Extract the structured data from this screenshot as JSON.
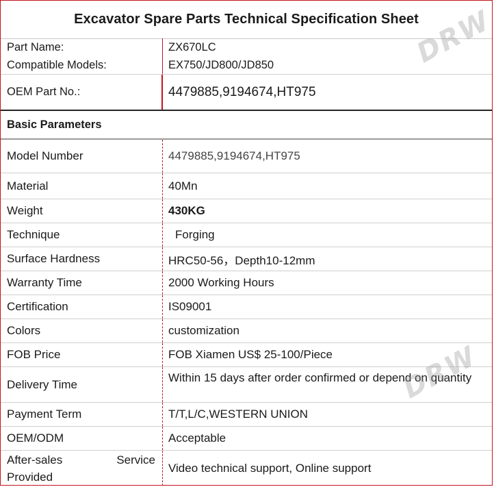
{
  "title": "Excavator Spare Parts Technical Specification Sheet",
  "watermark": "DRW",
  "top_rows": [
    {
      "label": "Part Name:",
      "value": "ZX670LC"
    },
    {
      "label": "Compatible Models:",
      "value": "EX750/JD800/JD850"
    },
    {
      "label": "OEM Part No.:",
      "value": "4479885,9194674,HT975"
    }
  ],
  "section_title": "Basic Parameters",
  "params": [
    {
      "label": "Model Number",
      "value": "4479885,9194674,HT975"
    },
    {
      "label": "Material",
      "value": "40Mn"
    },
    {
      "label": "Weight",
      "value": "430KG"
    },
    {
      "label": "Technique",
      "value": "Forging"
    },
    {
      "label": "Surface Hardness",
      "value": "HRC50-56，Depth10-12mm"
    },
    {
      "label": "Warranty Time",
      "value": "2000 Working Hours"
    },
    {
      "label": "Certification",
      "value": "IS09001"
    },
    {
      "label": "Colors",
      "value": "customization"
    },
    {
      "label": "FOB Price",
      "value": "FOB Xiamen US$ 25-100/Piece"
    },
    {
      "label": "Delivery Time",
      "value": "Within 15 days after order confirmed or depend on quantity"
    },
    {
      "label": "Payment Term",
      "value": "T/T,L/C,WESTERN UNION"
    },
    {
      "label": "OEM/ODM",
      "value": "Acceptable"
    },
    {
      "label": "After-sales Service Provided",
      "label_line1_a": "After-sales",
      "label_line1_b": "Service",
      "label_line2": "Provided",
      "value": "Video technical support, Online support"
    }
  ]
}
